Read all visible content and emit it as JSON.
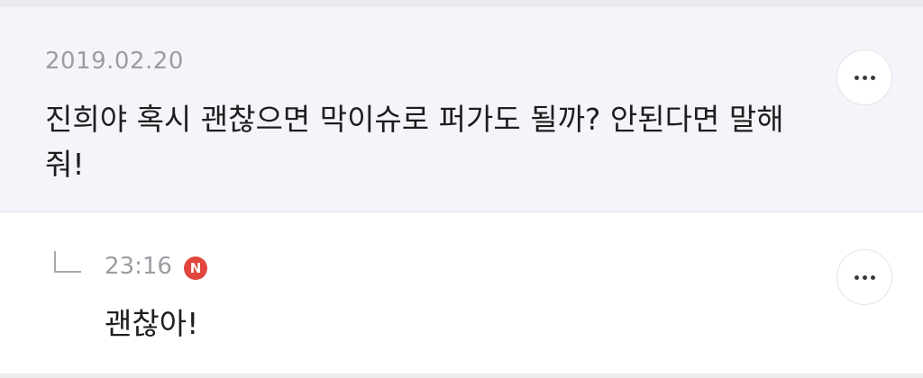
{
  "comment": {
    "date": "2019.02.20",
    "text": "진희야 혹시 괜찮으면 막이슈로 퍼가도 될까? 안된다면 말해줘!",
    "more_icon": "more-horizontal-icon"
  },
  "reply": {
    "reply_icon": "reply-arrow-icon",
    "time": "23:16",
    "badge": "N",
    "badge_color": "#e0463c",
    "text": "괜찮아!",
    "more_icon": "more-horizontal-icon"
  }
}
